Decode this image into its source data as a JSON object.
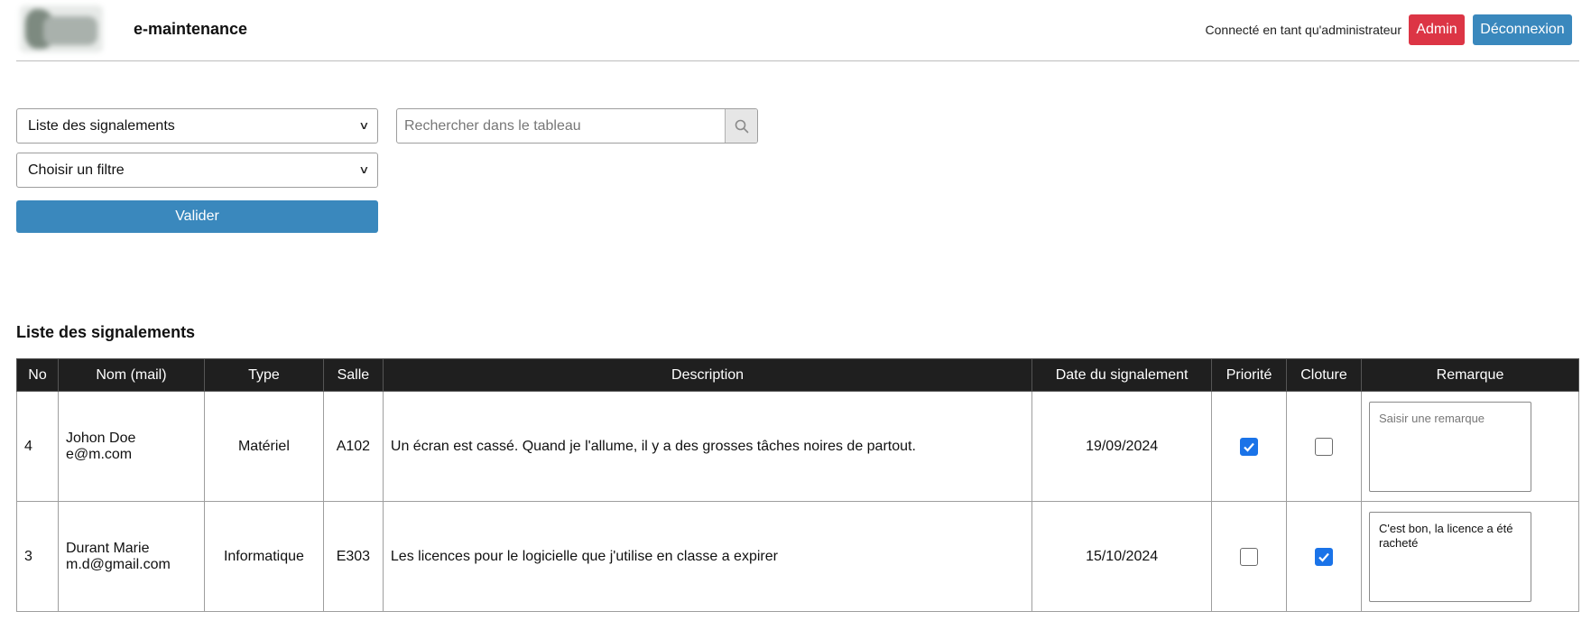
{
  "header": {
    "app_title": "e-maintenance",
    "user_status": "Connecté en tant qu'administrateur",
    "admin_label": "Admin",
    "logout_label": "Déconnexion"
  },
  "filters": {
    "list_select_value": "Liste des signalements",
    "filter_select_value": "Choisir un filtre",
    "submit_label": "Valider",
    "search_placeholder": "Rechercher dans le tableau"
  },
  "section_title": "Liste des signalements",
  "table": {
    "columns": [
      "No",
      "Nom (mail)",
      "Type",
      "Salle",
      "Description",
      "Date du signalement",
      "Priorité",
      "Cloture",
      "Remarque"
    ],
    "rows": [
      {
        "no": "4",
        "name": "Johon Doe",
        "email": "e@m.com",
        "type": "Matériel",
        "room": "A102",
        "description": "Un écran est cassé. Quand je l'allume, il y a des grosses tâches noires de partout.",
        "date": "19/09/2024",
        "priority": true,
        "closed": false,
        "remark": "",
        "remark_placeholder": "Saisir une remarque"
      },
      {
        "no": "3",
        "name": "Durant Marie",
        "email": "m.d@gmail.com",
        "type": "Informatique",
        "room": "E303",
        "description": "Les licences pour le logicielle que j'utilise en classe a expirer",
        "date": "15/10/2024",
        "priority": false,
        "closed": true,
        "remark": "C'est bon, la licence a été racheté",
        "remark_placeholder": ""
      }
    ]
  },
  "colors": {
    "admin": "#dc3545",
    "primary": "#3a88bd",
    "table_header": "#1f1f1f",
    "checkbox_checked": "#1a73e8"
  }
}
